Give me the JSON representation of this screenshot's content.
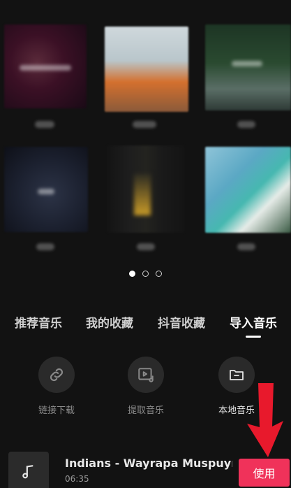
{
  "tabs": [
    {
      "label": "推荐音乐",
      "active": false
    },
    {
      "label": "我的收藏",
      "active": false
    },
    {
      "label": "抖音收藏",
      "active": false
    },
    {
      "label": "导入音乐",
      "active": true
    }
  ],
  "pagination": {
    "total": 3,
    "current": 1
  },
  "import_options": [
    {
      "label": "链接下载",
      "icon": "link-icon"
    },
    {
      "label": "提取音乐",
      "icon": "video-music-icon"
    },
    {
      "label": "本地音乐",
      "icon": "folder-icon"
    }
  ],
  "track": {
    "title": "Indians - Wayrapa Muspuyni...",
    "duration": "06:35",
    "use_label": "使用",
    "icon": "music-note-icon"
  },
  "colors": {
    "background": "#121212",
    "accent": "#f0325a",
    "annotation_arrow": "#e8192c"
  }
}
